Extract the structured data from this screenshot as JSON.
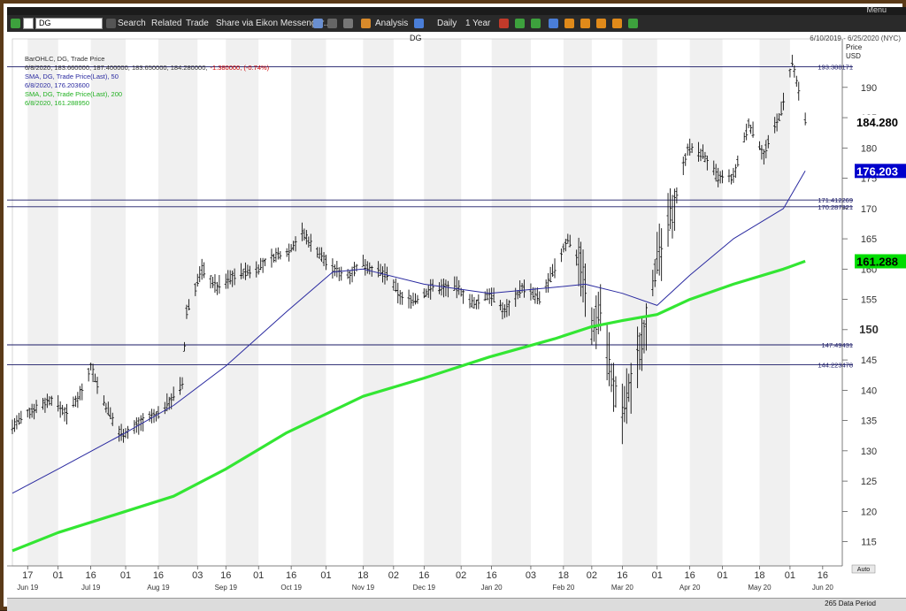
{
  "window": {
    "menu_label": "Menu"
  },
  "toolbar": {
    "ric": "DG",
    "search": "Search",
    "related": "Related",
    "trade": "Trade",
    "share": "Share via Eikon Messenger...",
    "analysis": "Analysis",
    "interval": "Daily",
    "period": "1 Year"
  },
  "header": {
    "symbol": "DG",
    "date_range": "6/10/2019 - 6/25/2020 (NYC)"
  },
  "legend": {
    "line1": "BarOHLC, DG, Trade Price",
    "line2": "6/8/2020, 183.660000, 187.400000, 183.650000, 184.280000,",
    "line2_change": "-1.380000, (-0.74%)",
    "line3": "SMA, DG, Trade Price(Last), 50",
    "line4": "6/8/2020, 176.203600",
    "line5": "SMA, DG, Trade Price(Last), 200",
    "line6": "6/8/2020, 161.288950"
  },
  "footer": {
    "data_period": "265 Data Period"
  },
  "chart_data": {
    "type": "line",
    "title": "DG",
    "ylabel": "Price USD",
    "ylim": [
      111,
      198
    ],
    "y_ticks": [
      115,
      120,
      125,
      130,
      135,
      140,
      145,
      150,
      155,
      160,
      165,
      170,
      175,
      180,
      185,
      190
    ],
    "y_major_tick": 150,
    "x_day_ticks": [
      {
        "label": "17",
        "date": "2019-06-17"
      },
      {
        "label": "01",
        "date": "2019-07-01"
      },
      {
        "label": "16",
        "date": "2019-07-16"
      },
      {
        "label": "01",
        "date": "2019-08-01"
      },
      {
        "label": "16",
        "date": "2019-08-16"
      },
      {
        "label": "03",
        "date": "2019-09-03"
      },
      {
        "label": "16",
        "date": "2019-09-16"
      },
      {
        "label": "01",
        "date": "2019-10-01"
      },
      {
        "label": "16",
        "date": "2019-10-16"
      },
      {
        "label": "01",
        "date": "2019-11-01"
      },
      {
        "label": "18",
        "date": "2019-11-18"
      },
      {
        "label": "02",
        "date": "2019-12-02"
      },
      {
        "label": "16",
        "date": "2019-12-16"
      },
      {
        "label": "02",
        "date": "2020-01-02"
      },
      {
        "label": "16",
        "date": "2020-01-16"
      },
      {
        "label": "03",
        "date": "2020-02-03"
      },
      {
        "label": "18",
        "date": "2020-02-18"
      },
      {
        "label": "02",
        "date": "2020-03-02"
      },
      {
        "label": "16",
        "date": "2020-03-16"
      },
      {
        "label": "01",
        "date": "2020-04-01"
      },
      {
        "label": "16",
        "date": "2020-04-16"
      },
      {
        "label": "01",
        "date": "2020-05-01"
      },
      {
        "label": "18",
        "date": "2020-05-18"
      },
      {
        "label": "01",
        "date": "2020-06-01"
      },
      {
        "label": "16",
        "date": "2020-06-16"
      }
    ],
    "x_month_labels": [
      {
        "label": "Jun 19",
        "date": "2019-06-17"
      },
      {
        "label": "Jul 19",
        "date": "2019-07-16"
      },
      {
        "label": "Aug 19",
        "date": "2019-08-16"
      },
      {
        "label": "Sep 19",
        "date": "2019-09-16"
      },
      {
        "label": "Oct 19",
        "date": "2019-10-16"
      },
      {
        "label": "Nov 19",
        "date": "2019-11-18"
      },
      {
        "label": "Dec 19",
        "date": "2019-12-16"
      },
      {
        "label": "Jan 20",
        "date": "2020-01-16"
      },
      {
        "label": "Feb 20",
        "date": "2020-02-18"
      },
      {
        "label": "Mar 20",
        "date": "2020-03-16"
      },
      {
        "label": "Apr 20",
        "date": "2020-04-16"
      },
      {
        "label": "May 20",
        "date": "2020-05-18"
      },
      {
        "label": "Jun 20",
        "date": "2020-06-16"
      }
    ],
    "horizontal_lines": [
      {
        "label": "193.388171",
        "value": 193.388171
      },
      {
        "label": "171.412269",
        "value": 171.412269
      },
      {
        "label": "170.287921",
        "value": 170.287921
      },
      {
        "label": "147.49431",
        "value": 147.49431
      },
      {
        "label": "144.223478",
        "value": 144.223478
      }
    ],
    "last_values": [
      {
        "label": "184.280",
        "value": 184.28,
        "color": "#000000"
      },
      {
        "label": "176.203",
        "value": 176.2036,
        "color": "#0000cc"
      },
      {
        "label": "161.288",
        "value": 161.28895,
        "color": "#00dd00"
      }
    ],
    "price_anchors": {
      "x": [
        "2019-06-10",
        "2019-06-20",
        "2019-06-28",
        "2019-07-05",
        "2019-07-12",
        "2019-07-16",
        "2019-07-22",
        "2019-07-29",
        "2019-08-02",
        "2019-08-09",
        "2019-08-16",
        "2019-08-23",
        "2019-08-27",
        "2019-08-29",
        "2019-09-05",
        "2019-09-12",
        "2019-09-20",
        "2019-09-30",
        "2019-10-08",
        "2019-10-15",
        "2019-10-21",
        "2019-10-28",
        "2019-11-04",
        "2019-11-11",
        "2019-11-18",
        "2019-11-22",
        "2019-11-29",
        "2019-12-06",
        "2019-12-13",
        "2019-12-20",
        "2019-12-31",
        "2020-01-08",
        "2020-01-15",
        "2020-01-22",
        "2020-01-30",
        "2020-02-07",
        "2020-02-14",
        "2020-02-20",
        "2020-02-26",
        "2020-03-02",
        "2020-03-06",
        "2020-03-12",
        "2020-03-16",
        "2020-03-20",
        "2020-03-26",
        "2020-03-31",
        "2020-04-03",
        "2020-04-09",
        "2020-04-15",
        "2020-04-22",
        "2020-04-29",
        "2020-05-06",
        "2020-05-13",
        "2020-05-20",
        "2020-05-28",
        "2020-06-02",
        "2020-06-08"
      ],
      "y": [
        134,
        137,
        138.5,
        136,
        140,
        144,
        138,
        133,
        133,
        135,
        136,
        139,
        141,
        153,
        160,
        157,
        159,
        160,
        162,
        163,
        166,
        163,
        160,
        159,
        161,
        160,
        159,
        155,
        155,
        157,
        157,
        154,
        156,
        153,
        157,
        155,
        160,
        165,
        161,
        150,
        154,
        140,
        136,
        141,
        150,
        160,
        163,
        171,
        180,
        179,
        175,
        175,
        184,
        179,
        186,
        194,
        184.28
      ]
    },
    "series": [
      {
        "name": "SMA, DG, Trade Price(Last), 50",
        "color": "#2a2aa0",
        "x": [
          "2019-06-10",
          "2019-07-01",
          "2019-08-01",
          "2019-08-23",
          "2019-09-16",
          "2019-10-14",
          "2019-11-04",
          "2019-11-18",
          "2019-12-16",
          "2020-01-15",
          "2020-02-14",
          "2020-02-28",
          "2020-03-16",
          "2020-04-01",
          "2020-04-16",
          "2020-05-06",
          "2020-05-29",
          "2020-06-08"
        ],
        "values": [
          123,
          127,
          133,
          137.5,
          144,
          153,
          159.5,
          160,
          157.5,
          156,
          157,
          157.5,
          156,
          154,
          159,
          165,
          170,
          176.2
        ]
      },
      {
        "name": "SMA, DG, Trade Price(Last), 200",
        "color": "#33e633",
        "x": [
          "2019-06-10",
          "2019-07-01",
          "2019-08-01",
          "2019-08-23",
          "2019-09-16",
          "2019-10-14",
          "2019-11-18",
          "2019-12-16",
          "2020-01-15",
          "2020-02-14",
          "2020-03-02",
          "2020-03-16",
          "2020-04-01",
          "2020-04-16",
          "2020-05-06",
          "2020-05-29",
          "2020-06-08"
        ],
        "values": [
          113.5,
          116.5,
          120,
          122.5,
          127,
          133,
          139,
          142,
          145.5,
          148.5,
          150.5,
          151.5,
          152.5,
          155,
          157.5,
          160,
          161.3
        ]
      }
    ]
  }
}
